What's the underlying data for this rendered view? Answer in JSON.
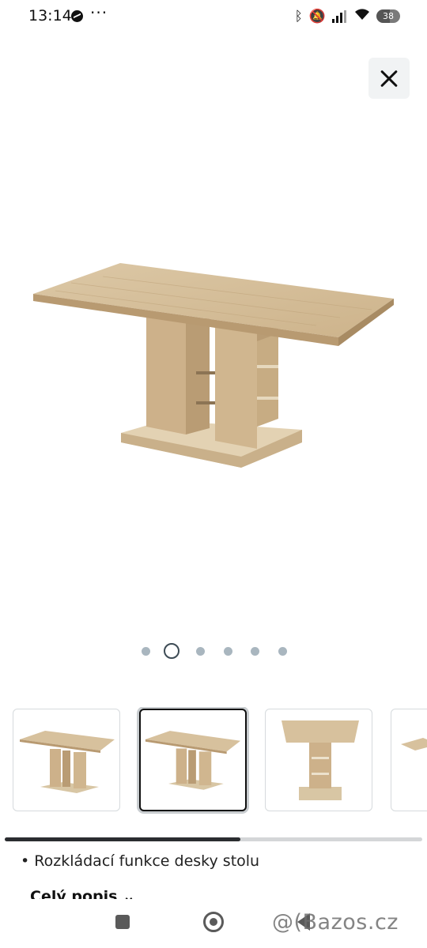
{
  "status_bar": {
    "time": "13:14",
    "battery": "38",
    "icons": [
      "messenger-icon",
      "more-dots-icon",
      "bluetooth-icon",
      "mute-icon",
      "signal-icon",
      "wifi-icon",
      "battery-icon"
    ]
  },
  "gallery": {
    "total_images": 6,
    "current_index": 1,
    "thumbnails_visible": 4,
    "selected_thumbnail": 1,
    "scroll_progress": 0.56
  },
  "details": {
    "feature_text": "• Rozkládací funkce desky stolu",
    "description_link": "Celý popis ⌄"
  },
  "watermark": "@(Bazos.cz",
  "colors": {
    "wood_light": "#d8c3a0",
    "wood_mid": "#c8ae86",
    "wood_dark": "#a98c64",
    "close_bg": "#f1f3f4",
    "pager_inactive": "#a9b6bf",
    "pager_active": "#3d4b55"
  }
}
